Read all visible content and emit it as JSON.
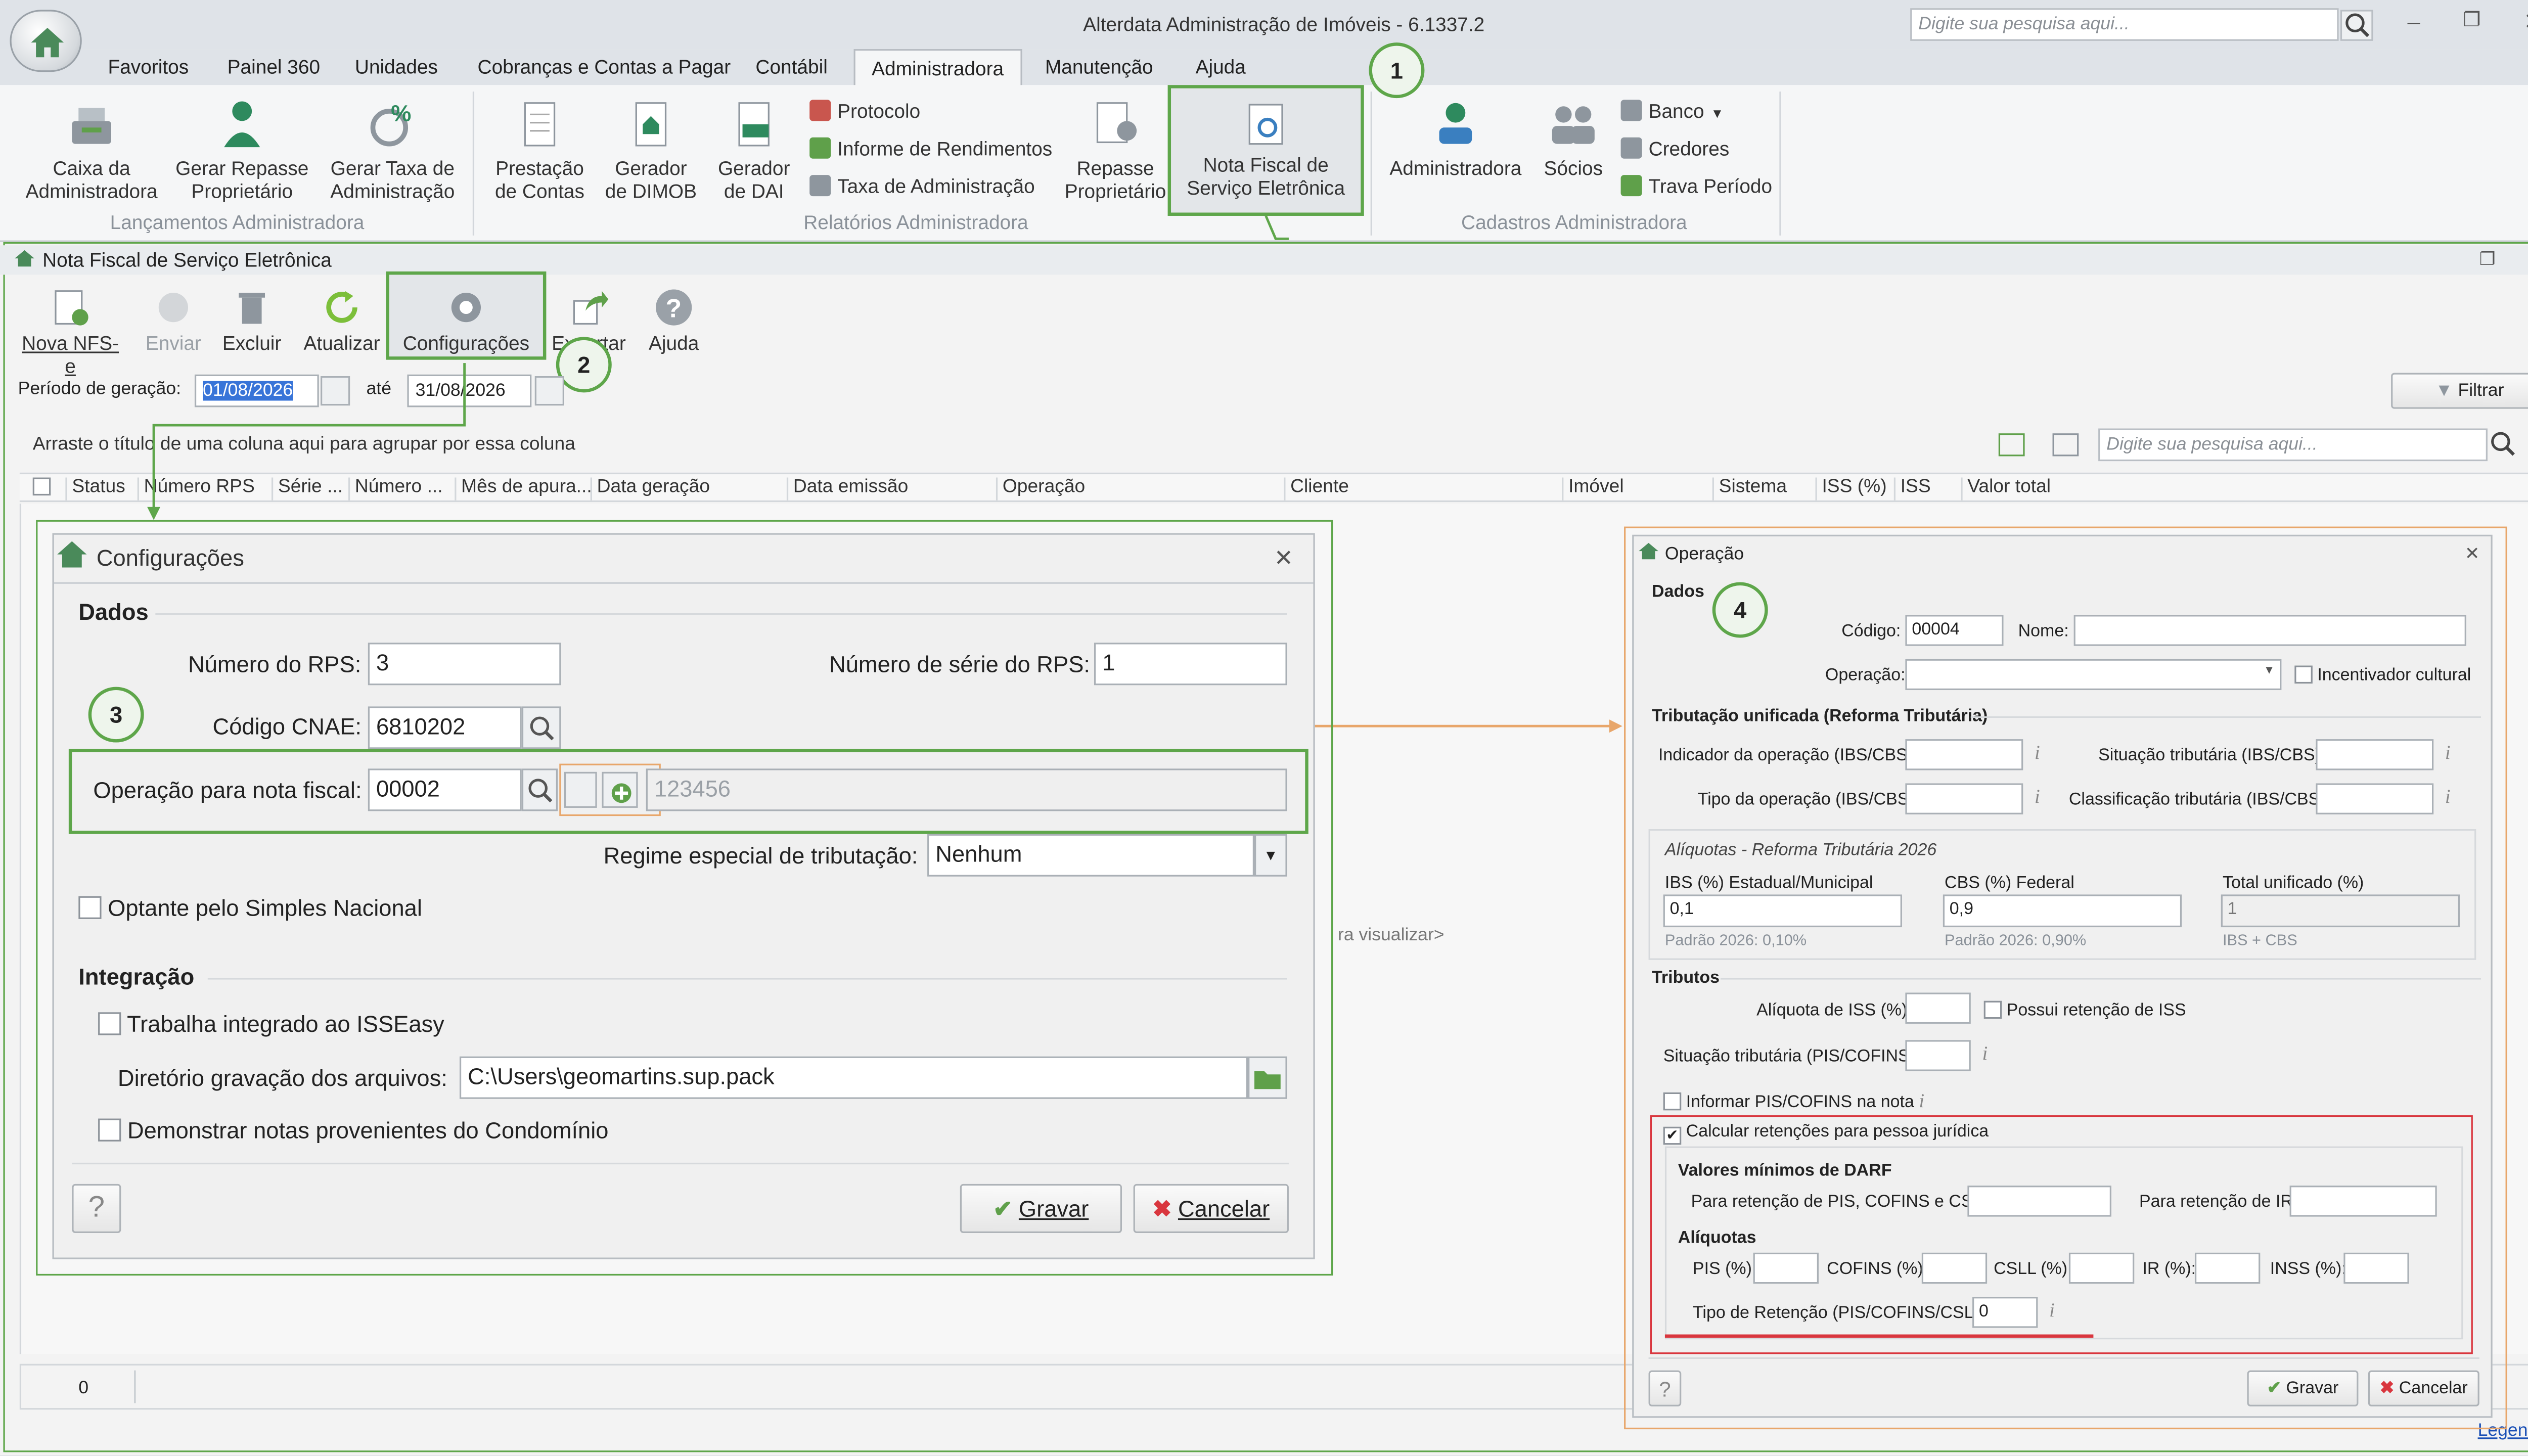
{
  "app": {
    "title": "Alterdata Administração de Imóveis - 6.1337.2",
    "search_placeholder": "Digite sua pesquisa aqui..."
  },
  "menu": [
    "Favoritos",
    "Painel 360",
    "Unidades",
    "Cobranças e Contas a Pagar",
    "Contábil",
    "Administradora",
    "Manutenção",
    "Ajuda"
  ],
  "ribbon": {
    "b1": "Caixa da\nAdministradora",
    "b2": "Gerar Repasse\nProprietário",
    "b3": "Gerar Taxa de\nAdministração",
    "g1": "Lançamentos Administradora",
    "b4": "Prestação\nde Contas",
    "b5": "Gerador\nde DIMOB",
    "b6": "Gerador\nde DAI",
    "s1": "Protocolo",
    "s2": "Informe de Rendimentos",
    "s3": "Taxa de Administração",
    "b7": "Repasse\nProprietário",
    "b8": "Nota Fiscal de\nServiço Eletrônica",
    "g2": "Relatórios Administradora",
    "b9": "Administradora",
    "b10": "Sócios",
    "s4": "Banco",
    "s5": "Credores",
    "s6": "Trava Período",
    "g3": "Cadastros Administradora"
  },
  "steps": [
    "1",
    "2",
    "3",
    "4"
  ],
  "doc": {
    "title": "Nota Fiscal de Serviço Eletrônica",
    "tools": [
      "Nova NFS-e",
      "Enviar",
      "Excluir",
      "Atualizar",
      "Configurações",
      "Exportar",
      "Ajuda"
    ],
    "periodo_label": "Período de geração:",
    "periodo_de": "01/08/2026",
    "ate": "até",
    "periodo_ate": "31/08/2026",
    "filtrar": "Filtrar",
    "group_hint": "Arraste o título de uma coluna aqui para agrupar por essa coluna",
    "grid_search": "Digite sua pesquisa aqui...",
    "columns": [
      "Status",
      "Número RPS",
      "Série ...",
      "Número ...",
      "Mês de apura...",
      "Data geração",
      "Data emissão",
      "Operação",
      "Cliente",
      "Imóvel",
      "Sistema",
      "ISS (%)",
      "ISS",
      "Valor total"
    ],
    "empty_hint": "ra visualizar>",
    "status_count": "0",
    "legend": "Legenda"
  },
  "config": {
    "title": "Configurações",
    "dados": "Dados",
    "rps_label": "Número do RPS:",
    "rps_value": "3",
    "serie_label": "Número de série do RPS:",
    "serie_value": "1",
    "cnae_label": "Código CNAE:",
    "cnae_value": "6810202",
    "op_label": "Operação para nota fiscal:",
    "op_value": "00002",
    "op_desc": "123456",
    "regime_label": "Regime especial de tributação:",
    "regime_value": "Nenhum",
    "simples": "Optante pelo Simples Nacional",
    "integracao": "Integração",
    "isseasy": "Trabalha integrado ao ISSEasy",
    "dir_label": "Diretório gravação dos arquivos:",
    "dir_value": "C:\\Users\\geomartins.sup.pack",
    "condominio": "Demonstrar notas provenientes do Condomínio",
    "help": "?",
    "gravar": "Gravar",
    "cancelar": "Cancelar"
  },
  "operacao": {
    "title": "Operação",
    "dados": "Dados",
    "codigo_label": "Código:",
    "codigo_value": "00004",
    "nome_label": "Nome:",
    "operacao_label": "Operação:",
    "incentivador": "Incentivador cultural",
    "trib_title": "Tributação unificada (Reforma Tributária)",
    "ind_op": "Indicador da operação (IBS/CBS):",
    "sit_trib": "Situação tributária (IBS/CBS):",
    "tipo_op": "Tipo da operação (IBS/CBS):",
    "class_trib": "Classificação tributária (IBS/CBS):",
    "aliq_title": "Alíquotas - Reforma Tributária 2026",
    "ibs_label": "IBS (%) Estadual/Municipal",
    "ibs_value": "0,1",
    "ibs_hint": "Padrão 2026: 0,10%",
    "cbs_label": "CBS (%) Federal",
    "cbs_value": "0,9",
    "cbs_hint": "Padrão 2026: 0,90%",
    "total_label": "Total unificado (%)",
    "total_value": "1",
    "total_hint": "IBS + CBS",
    "tributos": "Tributos",
    "aliq_iss": "Alíquota de ISS (%):",
    "ret_iss": "Possui retenção de ISS",
    "sit_pis": "Situação tributária (PIS/COFINS):",
    "inf_pis": "Informar PIS/COFINS na nota",
    "calc_ret": "Calcular retenções para pessoa jurídica",
    "vmin": "Valores mínimos de DARF",
    "ret_pcc": "Para retenção de PIS, COFINS e CSLL:",
    "ret_ir": "Para retenção de IR:",
    "aliquotas": "Alíquotas",
    "pis": "PIS (%):",
    "cofins": "COFINS (%):",
    "csll": "CSLL (%):",
    "ir": "IR (%):",
    "inss": "INSS (%):",
    "tipo_ret": "Tipo de Retenção (PIS/COFINS/CSLL):",
    "tipo_ret_value": "0",
    "help": "?",
    "gravar": "Gravar",
    "cancelar": "Cancelar",
    "info": "i"
  }
}
